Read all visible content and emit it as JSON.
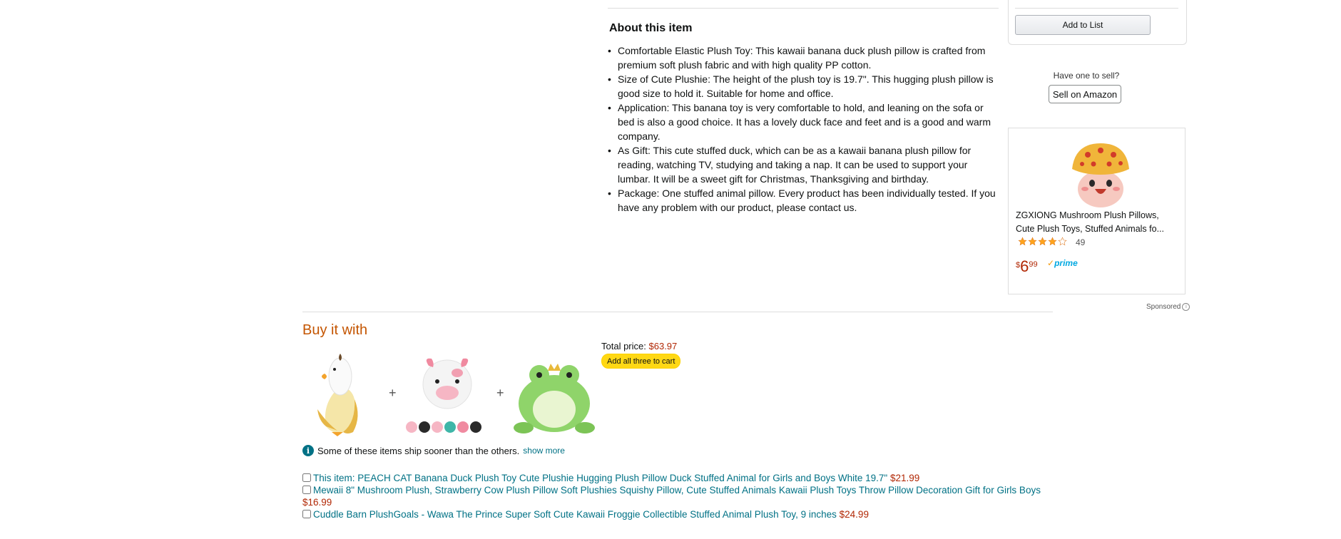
{
  "about": {
    "title": "About this item",
    "bullets": [
      "Comfortable Elastic Plush Toy: This kawaii banana duck plush pillow is crafted from premium soft plush fabric and with high quality PP cotton.",
      "Size of Cute Plushie: The height of the plush toy is 19.7\". This hugging plush pillow is good size to hold it. Suitable for home and office.",
      "Application: This banana toy is very comfortable to hold, and leaning on the sofa or bed is also a good choice. It has a lovely duck face and feet and is a good and warm company.",
      "As Gift: This cute stuffed duck, which can be as a kawaii banana plush pillow for reading, watching TV, studying and taking a nap. It can be used to support your lumbar. It will be a sweet gift for Christmas, Thanksgiving and birthday.",
      "Package: One stuffed animal pillow. Every product has been individually tested. If you have any problem with our product, please contact us."
    ]
  },
  "buybox": {
    "add_to_list": "Add to List",
    "have_one": "Have one to sell?",
    "sell_button": "Sell on Amazon"
  },
  "ad": {
    "title": "ZGXIONG Mushroom Plush Pillows, Cute Plush Toys, Stuffed Animals fo...",
    "rating": 4.0,
    "review_count": "49",
    "price_symbol": "$",
    "price_whole": "6",
    "price_fraction": "99",
    "prime": "prime",
    "sponsored": "Sponsored"
  },
  "buy_with": {
    "title": "Buy it with",
    "total_label": "Total price:",
    "total_value": "$63.97",
    "add_all_button": "Add all three to cart",
    "ship_note": "Some of these items ship sooner than the others.",
    "show_more": "show more",
    "items": [
      {
        "text": "This item: PEACH CAT Banana Duck Plush Toy Cute Plushie Hugging Plush Pillow Duck Stuffed Animal for Girls and Boys White 19.7\"",
        "price": "$21.99"
      },
      {
        "text": "Mewaii 8\" Mushroom Plush, Strawberry Cow Plush Pillow Soft Plushies Squishy Pillow, Cute Stuffed Animals Kawaii Plush Toys Throw Pillow Decoration Gift for Girls Boys",
        "price": "$16.99"
      },
      {
        "text": "Cuddle Barn PlushGoals - Wawa The Prince Super Soft Cute Kawaii Froggie Collectible Stuffed Animal Plush Toy, 9 inches",
        "price": "$24.99"
      }
    ]
  }
}
